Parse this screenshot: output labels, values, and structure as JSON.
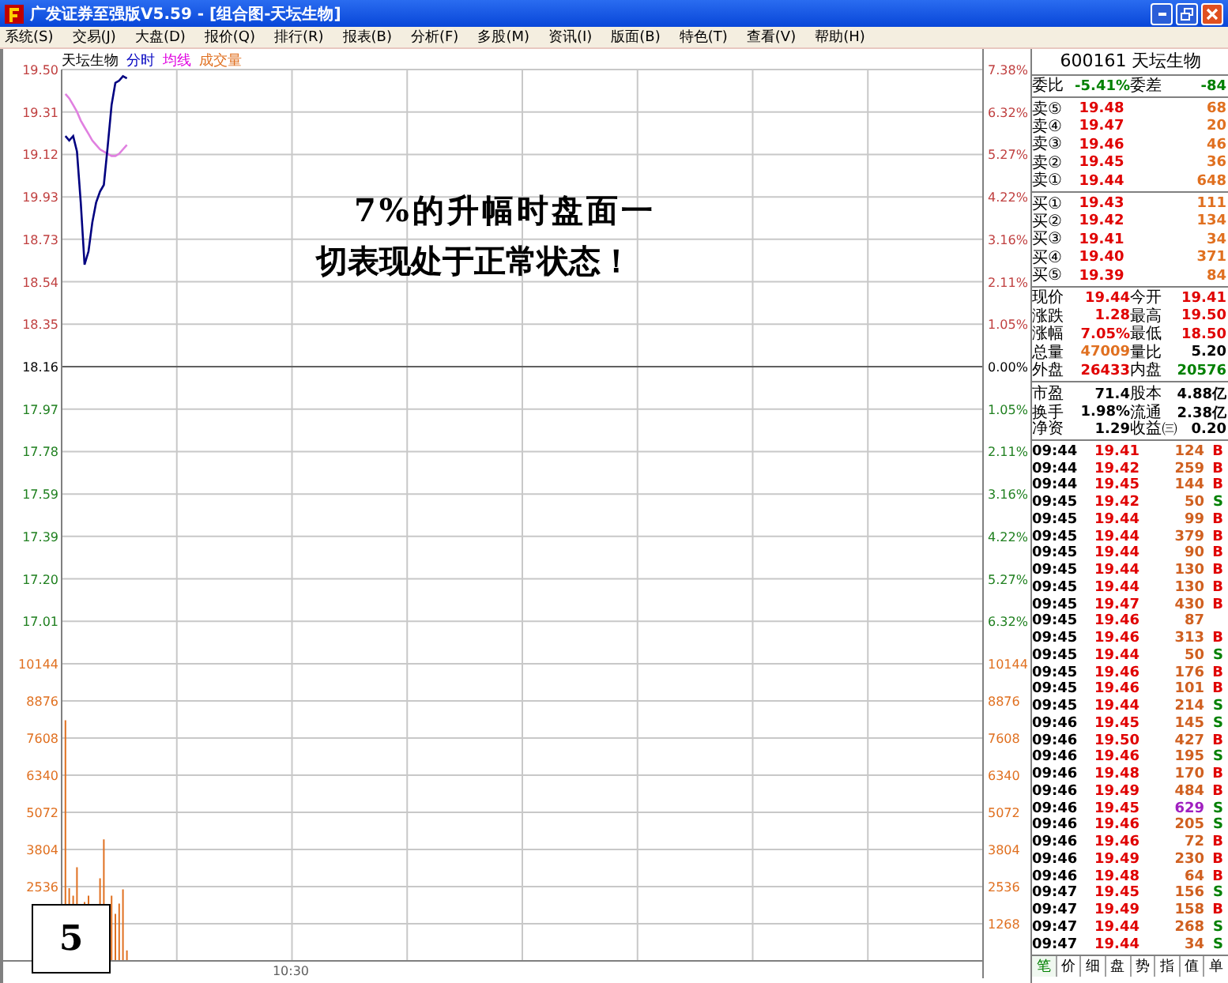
{
  "window": {
    "title": "广发证券至强版V5.59 - [组合图-天坛生物]"
  },
  "menu": [
    "系统(S)",
    "交易(J)",
    "大盘(D)",
    "报价(Q)",
    "排行(R)",
    "报表(B)",
    "分析(F)",
    "多股(M)",
    "资讯(I)",
    "版面(B)",
    "特色(T)",
    "查看(V)",
    "帮助(H)"
  ],
  "chart": {
    "legend": [
      {
        "label": "天坛生物",
        "color": "#000000"
      },
      {
        "label": "分时",
        "color": "#0000c0"
      },
      {
        "label": "均线",
        "color": "#e000e0"
      },
      {
        "label": "成交量",
        "color": "#e07020"
      }
    ],
    "price_labels": [
      {
        "label": "19.50",
        "color": "#c04040"
      },
      {
        "label": "19.31",
        "color": "#c04040"
      },
      {
        "label": "19.12",
        "color": "#c04040"
      },
      {
        "label": "19.93",
        "color": "#c04040"
      },
      {
        "label": "18.73",
        "color": "#c04040"
      },
      {
        "label": "18.54",
        "color": "#c04040"
      },
      {
        "label": "18.35",
        "color": "#c04040"
      },
      {
        "label": "18.16",
        "color": "#000000"
      },
      {
        "label": "17.97",
        "color": "#208020"
      },
      {
        "label": "17.78",
        "color": "#208020"
      },
      {
        "label": "17.59",
        "color": "#208020"
      },
      {
        "label": "17.39",
        "color": "#208020"
      },
      {
        "label": "17.20",
        "color": "#208020"
      },
      {
        "label": "17.01",
        "color": "#208020"
      }
    ],
    "percent_labels": [
      {
        "label": "7.38%",
        "color": "#c04040"
      },
      {
        "label": "6.32%",
        "color": "#c04040"
      },
      {
        "label": "5.27%",
        "color": "#c04040"
      },
      {
        "label": "4.22%",
        "color": "#c04040"
      },
      {
        "label": "3.16%",
        "color": "#c04040"
      },
      {
        "label": "2.11%",
        "color": "#c04040"
      },
      {
        "label": "1.05%",
        "color": "#c04040"
      },
      {
        "label": "0.00%",
        "color": "#000000"
      },
      {
        "label": "1.05%",
        "color": "#208020"
      },
      {
        "label": "2.11%",
        "color": "#208020"
      },
      {
        "label": "3.16%",
        "color": "#208020"
      },
      {
        "label": "4.22%",
        "color": "#208020"
      },
      {
        "label": "5.27%",
        "color": "#208020"
      },
      {
        "label": "6.32%",
        "color": "#208020"
      }
    ]
  },
  "volume": {
    "left_labels": [
      "10144",
      "8876",
      "7608",
      "6340",
      "5072",
      "3804",
      "2536"
    ],
    "right_labels": [
      "10144",
      "8876",
      "7608",
      "6340",
      "5072",
      "3804",
      "2536",
      "1268"
    ],
    "time_label": "10:30"
  },
  "annotation": {
    "lines": [
      "7%的升幅时盘面一",
      "切表现处于正常状态！"
    ]
  },
  "page_number": "5",
  "quote": {
    "header": "600161 天坛生物",
    "ratio": [
      {
        "label": "委比",
        "value": "-5.41%",
        "color": "#008000"
      },
      {
        "label": "委差",
        "value": "-84",
        "color": "#008000"
      }
    ],
    "sell": [
      {
        "label": "卖⑤",
        "price": "19.48",
        "volume": "68"
      },
      {
        "label": "卖④",
        "price": "19.47",
        "volume": "20"
      },
      {
        "label": "卖③",
        "price": "19.46",
        "volume": "46"
      },
      {
        "label": "卖②",
        "price": "19.45",
        "volume": "36"
      },
      {
        "label": "卖①",
        "price": "19.44",
        "volume": "648"
      }
    ],
    "buy": [
      {
        "label": "买①",
        "price": "19.43",
        "volume": "111"
      },
      {
        "label": "买②",
        "price": "19.42",
        "volume": "134"
      },
      {
        "label": "买③",
        "price": "19.41",
        "volume": "34"
      },
      {
        "label": "买④",
        "price": "19.40",
        "volume": "371"
      },
      {
        "label": "买⑤",
        "price": "19.39",
        "volume": "84"
      }
    ],
    "stats": [
      [
        {
          "label": "现价",
          "value": "19.44",
          "color": "#e00000"
        },
        {
          "label": "今开",
          "value": "19.41",
          "color": "#e00000"
        }
      ],
      [
        {
          "label": "涨跌",
          "value": "1.28",
          "color": "#e00000"
        },
        {
          "label": "最高",
          "value": "19.50",
          "color": "#e00000"
        }
      ],
      [
        {
          "label": "涨幅",
          "value": "7.05%",
          "color": "#e00000"
        },
        {
          "label": "最低",
          "value": "18.50",
          "color": "#e00000"
        }
      ],
      [
        {
          "label": "总量",
          "value": "47009",
          "color": "#e07020"
        },
        {
          "label": "量比",
          "value": "5.20",
          "color": "#000000"
        }
      ],
      [
        {
          "label": "外盘",
          "value": "26433",
          "color": "#e00000"
        },
        {
          "label": "内盘",
          "value": "20576",
          "color": "#008000"
        }
      ]
    ],
    "fundamentals": [
      [
        {
          "label": "市盈",
          "value": "71.4"
        },
        {
          "label": "股本",
          "value": "4.88亿"
        }
      ],
      [
        {
          "label": "换手",
          "value": "1.98%"
        },
        {
          "label": "流通",
          "value": "2.38亿"
        }
      ],
      [
        {
          "label": "净资",
          "value": "1.29"
        },
        {
          "label": "收益㈢",
          "value": "0.20"
        }
      ]
    ],
    "trades": [
      {
        "time": "09:44",
        "price": "19.41",
        "volume": "124",
        "side": "B",
        "large": false
      },
      {
        "time": "09:44",
        "price": "19.42",
        "volume": "259",
        "side": "B",
        "large": false
      },
      {
        "time": "09:44",
        "price": "19.45",
        "volume": "144",
        "side": "B",
        "large": false
      },
      {
        "time": "09:45",
        "price": "19.42",
        "volume": "50",
        "side": "S",
        "large": false
      },
      {
        "time": "09:45",
        "price": "19.44",
        "volume": "99",
        "side": "B",
        "large": false
      },
      {
        "time": "09:45",
        "price": "19.44",
        "volume": "379",
        "side": "B",
        "large": false
      },
      {
        "time": "09:45",
        "price": "19.44",
        "volume": "90",
        "side": "B",
        "large": false
      },
      {
        "time": "09:45",
        "price": "19.44",
        "volume": "130",
        "side": "B",
        "large": false
      },
      {
        "time": "09:45",
        "price": "19.44",
        "volume": "130",
        "side": "B",
        "large": false
      },
      {
        "time": "09:45",
        "price": "19.47",
        "volume": "430",
        "side": "B",
        "large": false
      },
      {
        "time": "09:45",
        "price": "19.46",
        "volume": "87",
        "large": false
      },
      {
        "time": "09:45",
        "price": "19.46",
        "volume": "313",
        "side": "B",
        "large": false
      },
      {
        "time": "09:45",
        "price": "19.44",
        "volume": "50",
        "side": "S",
        "large": false
      },
      {
        "time": "09:45",
        "price": "19.46",
        "volume": "176",
        "side": "B",
        "large": false
      },
      {
        "time": "09:45",
        "price": "19.46",
        "volume": "101",
        "side": "B",
        "large": false
      },
      {
        "time": "09:45",
        "price": "19.44",
        "volume": "214",
        "side": "S",
        "large": false
      },
      {
        "time": "09:46",
        "price": "19.45",
        "volume": "145",
        "side": "S",
        "large": false
      },
      {
        "time": "09:46",
        "price": "19.50",
        "volume": "427",
        "side": "B",
        "large": false
      },
      {
        "time": "09:46",
        "price": "19.46",
        "volume": "195",
        "side": "S",
        "large": false
      },
      {
        "time": "09:46",
        "price": "19.48",
        "volume": "170",
        "side": "B",
        "large": false
      },
      {
        "time": "09:46",
        "price": "19.49",
        "volume": "484",
        "side": "B",
        "large": false
      },
      {
        "time": "09:46",
        "price": "19.45",
        "volume": "629",
        "side": "S",
        "large": true
      },
      {
        "time": "09:46",
        "price": "19.46",
        "volume": "205",
        "side": "S",
        "large": false
      },
      {
        "time": "09:46",
        "price": "19.46",
        "volume": "72",
        "side": "B",
        "large": false
      },
      {
        "time": "09:46",
        "price": "19.49",
        "volume": "230",
        "side": "B",
        "large": false
      },
      {
        "time": "09:46",
        "price": "19.48",
        "volume": "64",
        "side": "B",
        "large": false
      },
      {
        "time": "09:47",
        "price": "19.45",
        "volume": "156",
        "side": "S",
        "large": false
      },
      {
        "time": "09:47",
        "price": "19.49",
        "volume": "158",
        "side": "B",
        "large": false
      },
      {
        "time": "09:47",
        "price": "19.44",
        "volume": "268",
        "side": "S",
        "large": false
      },
      {
        "time": "09:47",
        "price": "19.44",
        "volume": "34",
        "side": "S",
        "large": false
      }
    ],
    "tabs": [
      {
        "label": "笔",
        "selected": true
      },
      {
        "label": "价",
        "selected": false
      },
      {
        "label": "细",
        "selected": false
      },
      {
        "label": "盘",
        "selected": false
      },
      {
        "label": "势",
        "selected": false
      },
      {
        "label": "指",
        "selected": false
      },
      {
        "label": "值",
        "selected": false
      },
      {
        "label": "单",
        "selected": false
      }
    ]
  }
}
